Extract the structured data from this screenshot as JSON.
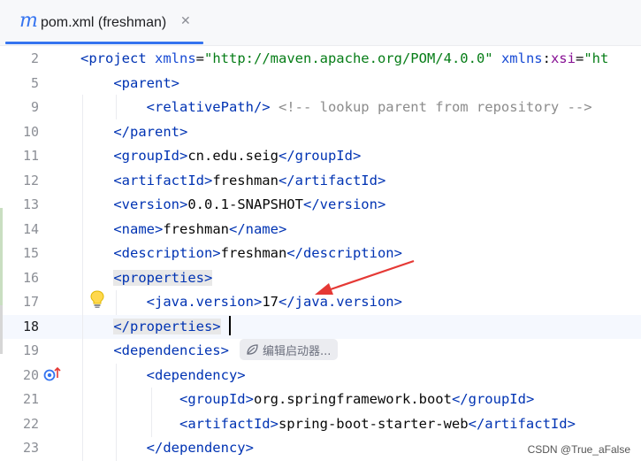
{
  "tab": {
    "icon_glyph": "m",
    "title": "pom.xml (freshman)",
    "close_glyph": "✕"
  },
  "inlay": {
    "label": "编辑启动器..."
  },
  "watermark": "CSDN @True_aFalse",
  "colors": {
    "accent": "#3574f0",
    "tag": "#0033b3",
    "string": "#067d17",
    "annotation_arrow": "#e53935"
  },
  "lines": [
    {
      "n": "2",
      "tokens": [
        [
          "t",
          "<project"
        ],
        [
          "a",
          " xmlns"
        ],
        [
          "p",
          "="
        ],
        [
          "s",
          "\"http://maven.apache.org/POM/4.0.0\""
        ],
        [
          "a",
          " xmlns"
        ],
        [
          "p",
          ":"
        ],
        [
          "ns",
          "xsi"
        ],
        [
          "p",
          "="
        ],
        [
          "s",
          "\"ht"
        ]
      ]
    },
    {
      "n": "5",
      "tokens": [
        [
          "p",
          "    "
        ],
        [
          "t",
          "<parent>"
        ]
      ]
    },
    {
      "n": "9",
      "tokens": [
        [
          "p",
          "        "
        ],
        [
          "t",
          "<relativePath/>"
        ],
        [
          "c",
          " <!-- lookup parent from repository -->"
        ]
      ]
    },
    {
      "n": "10",
      "tokens": [
        [
          "p",
          "    "
        ],
        [
          "t",
          "</parent>"
        ]
      ]
    },
    {
      "n": "11",
      "tokens": [
        [
          "p",
          "    "
        ],
        [
          "t",
          "<groupId>"
        ],
        [
          "p",
          "cn.edu.seig"
        ],
        [
          "t",
          "</groupId>"
        ]
      ]
    },
    {
      "n": "12",
      "tokens": [
        [
          "p",
          "    "
        ],
        [
          "t",
          "<artifactId>"
        ],
        [
          "p",
          "freshman"
        ],
        [
          "t",
          "</artifactId>"
        ]
      ]
    },
    {
      "n": "13",
      "tokens": [
        [
          "p",
          "    "
        ],
        [
          "t",
          "<version>"
        ],
        [
          "p",
          "0.0.1-SNAPSHOT"
        ],
        [
          "t",
          "</version>"
        ]
      ]
    },
    {
      "n": "14",
      "tokens": [
        [
          "p",
          "    "
        ],
        [
          "t",
          "<name>"
        ],
        [
          "p",
          "freshman"
        ],
        [
          "t",
          "</name>"
        ]
      ]
    },
    {
      "n": "15",
      "tokens": [
        [
          "p",
          "    "
        ],
        [
          "t",
          "<description>"
        ],
        [
          "p",
          "freshman"
        ],
        [
          "t",
          "</description>"
        ]
      ]
    },
    {
      "n": "16",
      "tokens": [
        [
          "p",
          "    "
        ],
        [
          "th",
          "<properties>"
        ]
      ]
    },
    {
      "n": "17",
      "tokens": [
        [
          "p",
          "        "
        ],
        [
          "t",
          "<java.version>"
        ],
        [
          "p",
          "17"
        ],
        [
          "t",
          "</java.version>"
        ]
      ]
    },
    {
      "n": "18",
      "tokens": [
        [
          "p",
          "    "
        ],
        [
          "th",
          "</properties>"
        ]
      ]
    },
    {
      "n": "19",
      "tokens": [
        [
          "p",
          "    "
        ],
        [
          "t",
          "<dependencies>"
        ]
      ]
    },
    {
      "n": "20",
      "tokens": [
        [
          "p",
          "        "
        ],
        [
          "t",
          "<dependency>"
        ]
      ]
    },
    {
      "n": "21",
      "tokens": [
        [
          "p",
          "            "
        ],
        [
          "t",
          "<groupId>"
        ],
        [
          "p",
          "org.springframework.boot"
        ],
        [
          "t",
          "</groupId>"
        ]
      ]
    },
    {
      "n": "22",
      "tokens": [
        [
          "p",
          "            "
        ],
        [
          "t",
          "<artifactId>"
        ],
        [
          "p",
          "spring-boot-starter-web"
        ],
        [
          "t",
          "</artifactId>"
        ]
      ]
    },
    {
      "n": "23",
      "tokens": [
        [
          "p",
          "        "
        ],
        [
          "t",
          "</dependency>"
        ]
      ]
    }
  ]
}
